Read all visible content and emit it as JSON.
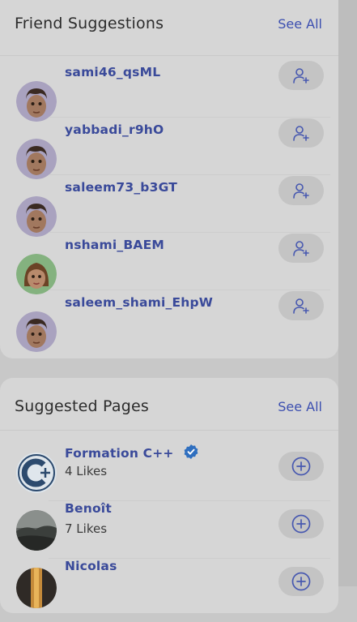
{
  "friend_suggestions": {
    "title": "Friend Suggestions",
    "see_all": "See All",
    "items": [
      {
        "username": "sami46_qsML",
        "avatar": "male-memoji-icon",
        "action": "add-friend-icon"
      },
      {
        "username": "yabbadi_r9hO",
        "avatar": "male-memoji-icon",
        "action": "add-friend-icon"
      },
      {
        "username": "saleem73_b3GT",
        "avatar": "male-memoji-icon",
        "action": "add-friend-icon"
      },
      {
        "username": "nshami_BAEM",
        "avatar": "female-memoji-icon",
        "action": "add-friend-icon"
      },
      {
        "username": "saleem_shami_EhpW",
        "avatar": "male-memoji-icon",
        "action": "add-friend-icon"
      }
    ]
  },
  "suggested_pages": {
    "title": "Suggested Pages",
    "see_all": "See All",
    "items": [
      {
        "name": "Formation C++",
        "likes": "4 Likes",
        "verified": true,
        "avatar": "cpp-logo-icon",
        "action": "add-circle-icon"
      },
      {
        "name": "Benoît",
        "likes": "7 Likes",
        "verified": false,
        "avatar": "landscape-photo-icon",
        "action": "add-circle-icon"
      },
      {
        "name": "Nicolas",
        "likes": "",
        "verified": false,
        "avatar": "sunset-photo-icon",
        "action": "add-circle-icon"
      }
    ]
  },
  "colors": {
    "accent": "#3c4fb0",
    "name_text": "#3a4a9a",
    "card_bg": "#d6d6d6",
    "page_bg": "#c8c8c8",
    "verified_badge": "#2f6fbf"
  }
}
